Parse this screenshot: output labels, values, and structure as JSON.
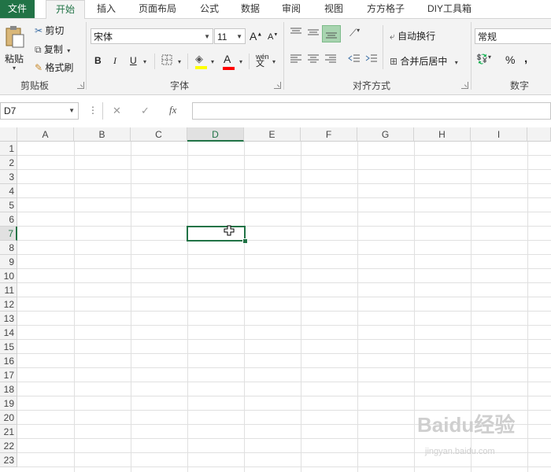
{
  "tabs": [
    "文件",
    "开始",
    "插入",
    "页面布局",
    "公式",
    "数据",
    "审阅",
    "视图",
    "方方格子",
    "DIY工具箱"
  ],
  "clipboard": {
    "paste": "粘贴",
    "cut": "剪切",
    "copy": "复制",
    "format_painter": "格式刷",
    "label": "剪贴板"
  },
  "font": {
    "name": "宋体",
    "size": "11",
    "bold": "B",
    "italic": "I",
    "underline": "U",
    "grow": "A",
    "shrink": "A",
    "color_letter": "A",
    "phonetic": "wén",
    "label": "字体"
  },
  "alignment": {
    "wrap_text": "自动换行",
    "merge_center": "合并后居中",
    "label": "对齐方式"
  },
  "number": {
    "format": "常规",
    "percent": "%",
    "comma": ",",
    "label": "数字"
  },
  "formula_bar": {
    "name_box": "D7",
    "more": "⋮",
    "cancel": "✕",
    "enter": "✓",
    "fx": "fx",
    "value": ""
  },
  "columns": [
    "A",
    "B",
    "C",
    "D",
    "E",
    "F",
    "G",
    "H",
    "I"
  ],
  "rows": [
    "1",
    "2",
    "3",
    "4",
    "5",
    "6",
    "7",
    "8",
    "9",
    "10",
    "11",
    "12",
    "13",
    "14",
    "15",
    "16",
    "17",
    "18",
    "19",
    "20",
    "21",
    "22",
    "23"
  ],
  "selected": {
    "column": "D",
    "row": "7"
  },
  "watermark": {
    "brand": "Baidu经验",
    "url": "jingyan.baidu.com"
  },
  "colors": {
    "accent": "#217346",
    "highlight": "#ffff00",
    "font_color": "#ff0000"
  }
}
